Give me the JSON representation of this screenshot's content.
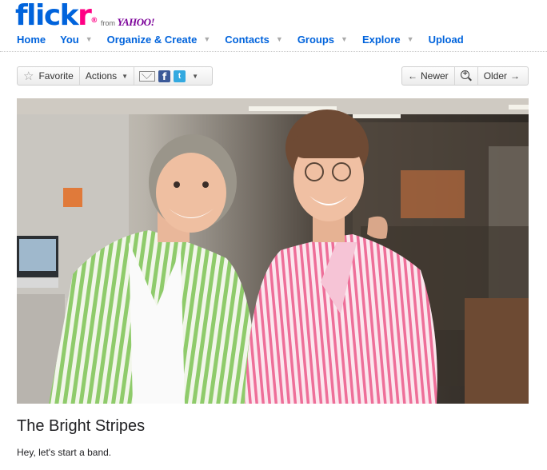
{
  "brand": {
    "logo_blue": "flick",
    "logo_pink": "r",
    "registered": "®",
    "from": "from",
    "yahoo": "YAHOO!"
  },
  "nav": {
    "items": [
      {
        "label": "Home",
        "has_menu": false
      },
      {
        "label": "You",
        "has_menu": true
      },
      {
        "label": "Organize & Create",
        "has_menu": true
      },
      {
        "label": "Contacts",
        "has_menu": true
      },
      {
        "label": "Groups",
        "has_menu": true
      },
      {
        "label": "Explore",
        "has_menu": true
      },
      {
        "label": "Upload",
        "has_menu": false
      }
    ]
  },
  "toolbar": {
    "favorite_label": "Favorite",
    "actions_label": "Actions",
    "share_icons": [
      "email-icon",
      "facebook-icon",
      "twitter-icon"
    ],
    "newer_label": "Newer",
    "older_label": "Older"
  },
  "photo": {
    "title": "The Bright Stripes",
    "description": "Hey, let's start a band."
  },
  "colors": {
    "link": "#0063dc",
    "brand_pink": "#ff0084",
    "yahoo_purple": "#7b0099"
  }
}
